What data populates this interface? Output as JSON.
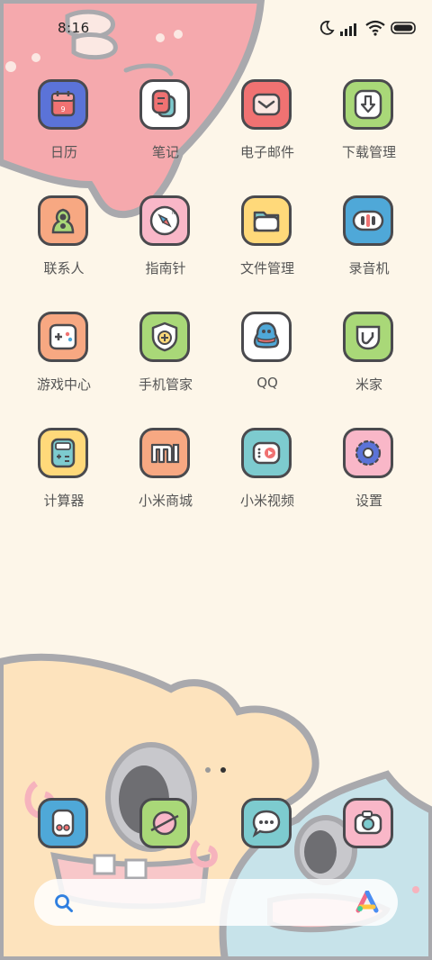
{
  "status_bar": {
    "time": "8:16",
    "icons": [
      "moon-icon",
      "signal-icon",
      "wifi-icon",
      "battery-icon"
    ]
  },
  "apps": [
    {
      "label": "日历",
      "icon": "calendar-icon",
      "bg": "#5b73d8"
    },
    {
      "label": "笔记",
      "icon": "notes-icon",
      "bg": "#ffffff"
    },
    {
      "label": "电子邮件",
      "icon": "email-icon",
      "bg": "#f07272"
    },
    {
      "label": "下载管理",
      "icon": "download-icon",
      "bg": "#a9d878"
    },
    {
      "label": "联系人",
      "icon": "contacts-icon",
      "bg": "#f7a882"
    },
    {
      "label": "指南针",
      "icon": "compass-icon",
      "bg": "#f9b7c8"
    },
    {
      "label": "文件管理",
      "icon": "folder-icon",
      "bg": "#ffd97a"
    },
    {
      "label": "录音机",
      "icon": "recorder-icon",
      "bg": "#4fa8d8"
    },
    {
      "label": "游戏中心",
      "icon": "gamepad-icon",
      "bg": "#f7a882"
    },
    {
      "label": "手机管家",
      "icon": "shield-icon",
      "bg": "#a9d878"
    },
    {
      "label": "QQ",
      "icon": "qq-penguin-icon",
      "bg": "#ffffff"
    },
    {
      "label": "米家",
      "icon": "mijia-icon",
      "bg": "#a9d878"
    },
    {
      "label": "计算器",
      "icon": "calculator-icon",
      "bg": "#ffd97a"
    },
    {
      "label": "小米商城",
      "icon": "mi-store-icon",
      "bg": "#f7a882"
    },
    {
      "label": "小米视频",
      "icon": "video-icon",
      "bg": "#7dcbcf"
    },
    {
      "label": "设置",
      "icon": "gear-icon",
      "bg": "#f9b7c8"
    }
  ],
  "page_indicator": {
    "pages": 2,
    "current": 2
  },
  "dock": [
    {
      "icon": "phone-dialer-icon",
      "bg": "#4fa8d8"
    },
    {
      "icon": "browser-planet-icon",
      "bg": "#a9d878"
    },
    {
      "icon": "messages-icon",
      "bg": "#7dcbcf"
    },
    {
      "icon": "camera-icon",
      "bg": "#f9b7c8"
    }
  ],
  "search_bar": {
    "left_icon": "search-icon",
    "right_icon": "assistant-icon"
  }
}
